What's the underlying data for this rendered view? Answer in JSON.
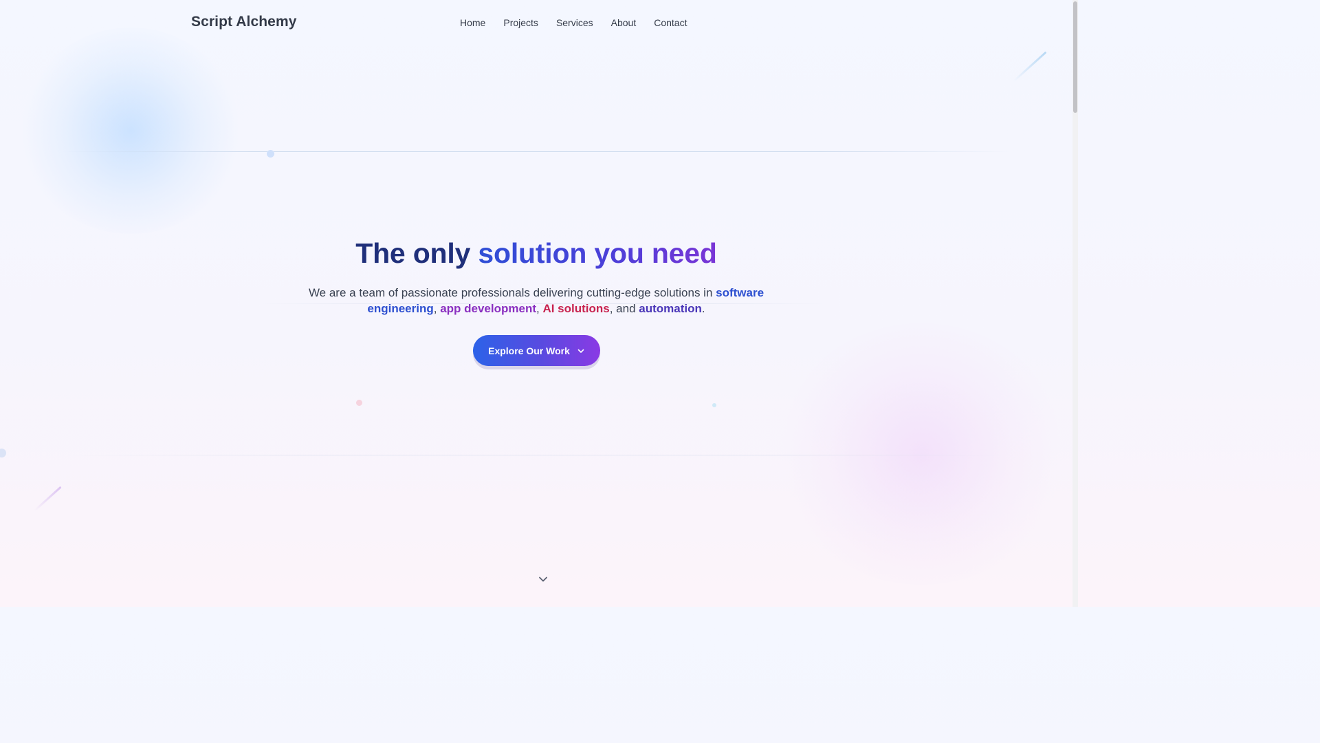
{
  "header": {
    "logo": "Script Alchemy",
    "nav": [
      "Home",
      "Projects",
      "Services",
      "About",
      "Contact"
    ]
  },
  "hero": {
    "title_dark": "The only ",
    "title_gradient": "solution you need",
    "subtitle": {
      "intro": "We are a team of passionate professionals delivering cutting-edge solutions in ",
      "software_engineering": "software engineering",
      "sep1": ", ",
      "app_development": "app development",
      "sep2": ", ",
      "ai_solutions": "AI solutions",
      "sep3": ", and ",
      "automation": "automation",
      "end": "."
    },
    "cta_label": "Explore Our Work",
    "cta_icon": "chevron-down-icon"
  },
  "scroll_indicator_icon": "chevron-down-icon",
  "colors": {
    "title_dark": "#1f2f7a",
    "accent_blue": "#2d4fd0",
    "accent_purple": "#8a2fc0",
    "accent_red": "#c8234f",
    "accent_indigo": "#4a36b8",
    "cta_start": "#2c62e8",
    "cta_end": "#8a3ae4"
  }
}
